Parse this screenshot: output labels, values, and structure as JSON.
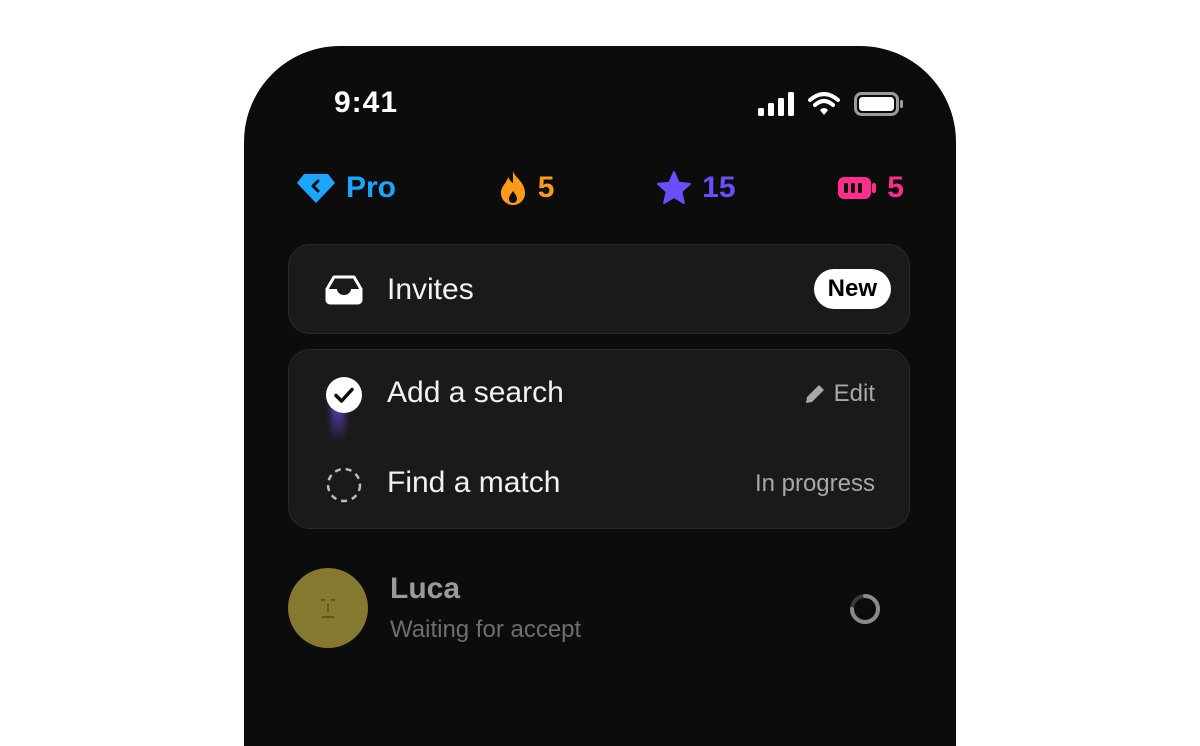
{
  "status_bar": {
    "time": "9:41",
    "icons": [
      "cellular-signal-icon",
      "wifi-icon",
      "battery-icon"
    ]
  },
  "stats": {
    "pro": {
      "label": "Pro",
      "icon": "diamond-icon",
      "color": "#1aa6ff"
    },
    "streak": {
      "value": "5",
      "icon": "flame-icon",
      "color": "#ff9a1a"
    },
    "stars": {
      "value": "15",
      "icon": "star-icon",
      "color": "#6b4dff"
    },
    "energy": {
      "value": "5",
      "icon": "battery-charge-icon",
      "color": "#ff2e8a"
    }
  },
  "invites": {
    "label": "Invites",
    "icon": "inbox-icon",
    "badge": "New"
  },
  "tasks": [
    {
      "label": "Add a search",
      "icon": "check-circle-icon",
      "action": "Edit",
      "action_icon": "pencil-icon",
      "completed": true
    },
    {
      "label": "Find a match",
      "icon": "dashed-circle-icon",
      "status": "In progress",
      "completed": false
    }
  ],
  "contact": {
    "name": "Luca",
    "status": "Waiting for accept",
    "avatar_color": "#85782f"
  }
}
